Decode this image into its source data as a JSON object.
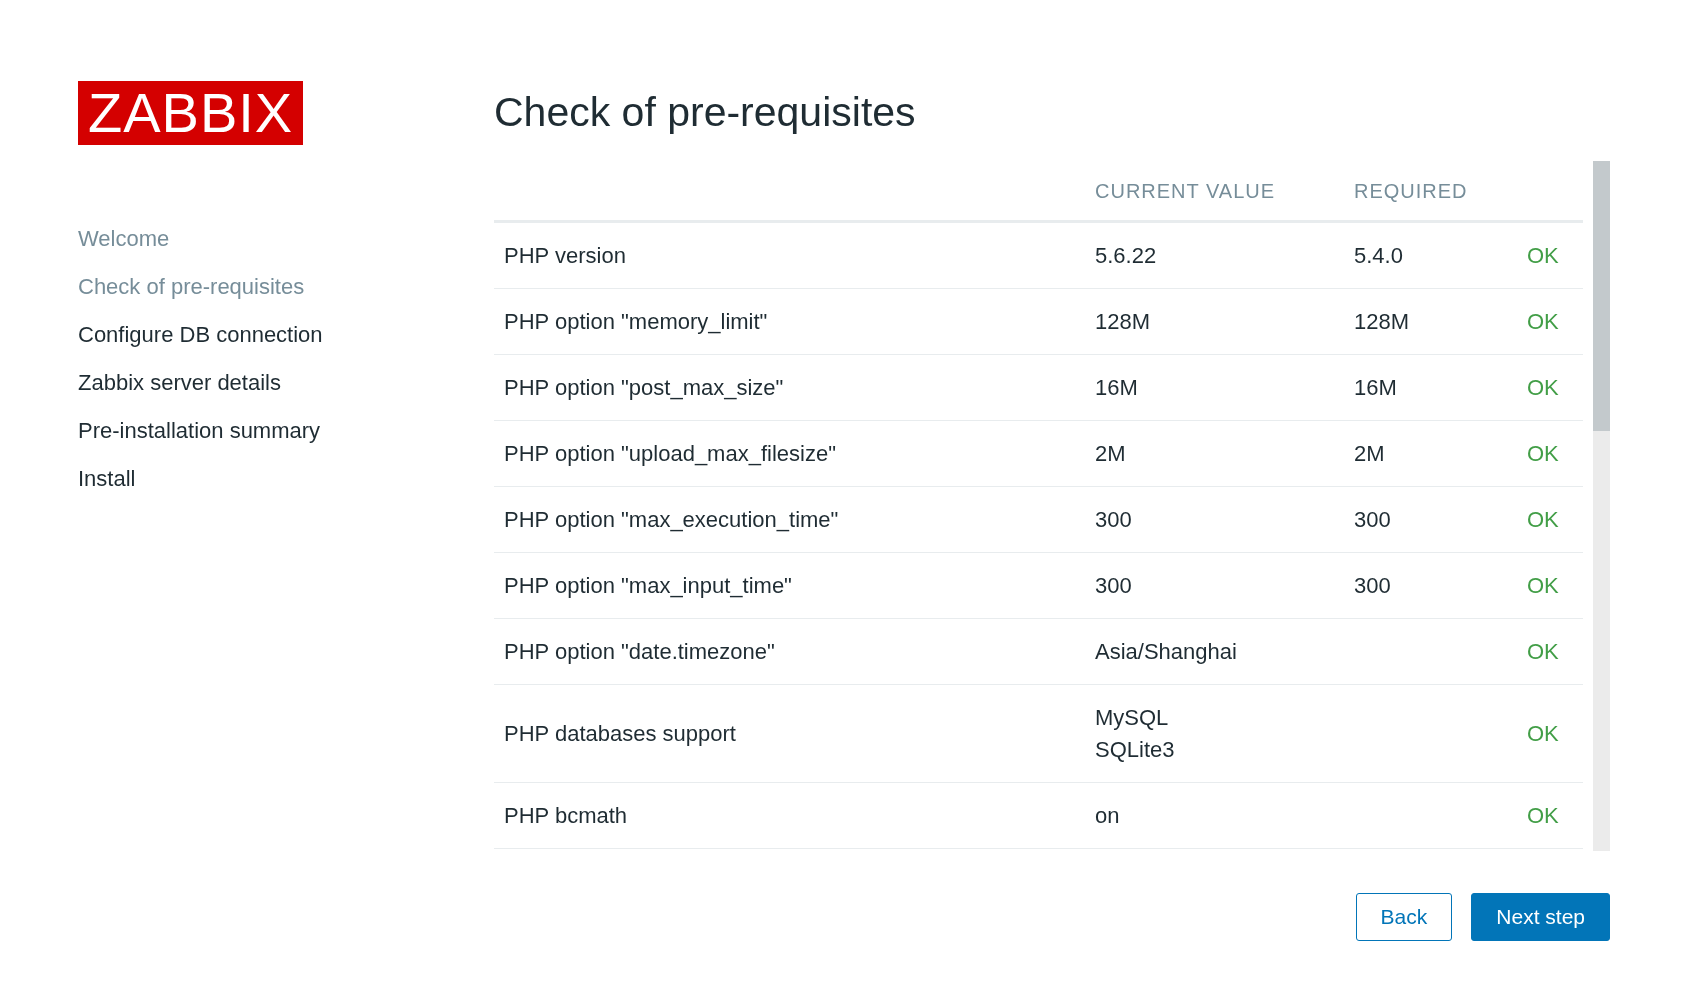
{
  "logo": "ZABBIX",
  "sidebar": {
    "items": [
      {
        "label": "Welcome",
        "dimmed": true
      },
      {
        "label": "Check of pre-requisites",
        "dimmed": true
      },
      {
        "label": "Configure DB connection",
        "dimmed": false
      },
      {
        "label": "Zabbix server details",
        "dimmed": false
      },
      {
        "label": "Pre-installation summary",
        "dimmed": false
      },
      {
        "label": "Install",
        "dimmed": false
      }
    ]
  },
  "title": "Check of pre-requisites",
  "table": {
    "columns": [
      "CURRENT VALUE",
      "REQUIRED"
    ],
    "rows": [
      {
        "name": "PHP version",
        "current": [
          "5.6.22"
        ],
        "required": "5.4.0",
        "status": "OK",
        "passed": true
      },
      {
        "name": "PHP option \"memory_limit\"",
        "current": [
          "128M"
        ],
        "required": "128M",
        "status": "OK",
        "passed": true
      },
      {
        "name": "PHP option \"post_max_size\"",
        "current": [
          "16M"
        ],
        "required": "16M",
        "status": "OK",
        "passed": true
      },
      {
        "name": "PHP option \"upload_max_filesize\"",
        "current": [
          "2M"
        ],
        "required": "2M",
        "status": "OK",
        "passed": true
      },
      {
        "name": "PHP option \"max_execution_time\"",
        "current": [
          "300"
        ],
        "required": "300",
        "status": "OK",
        "passed": true
      },
      {
        "name": "PHP option \"max_input_time\"",
        "current": [
          "300"
        ],
        "required": "300",
        "status": "OK",
        "passed": true
      },
      {
        "name": "PHP option \"date.timezone\"",
        "current": [
          "Asia/Shanghai"
        ],
        "status": "OK",
        "passed": true
      },
      {
        "name": "PHP databases support",
        "current": [
          "MySQL",
          "SQLite3"
        ],
        "status": "OK",
        "passed": true
      },
      {
        "name": "PHP bcmath",
        "current": [
          "on"
        ],
        "status": "OK",
        "passed": true
      }
    ]
  },
  "buttons": [
    {
      "label": "Back",
      "kind": "secondary"
    },
    {
      "label": "Next step",
      "kind": "primary"
    }
  ]
}
